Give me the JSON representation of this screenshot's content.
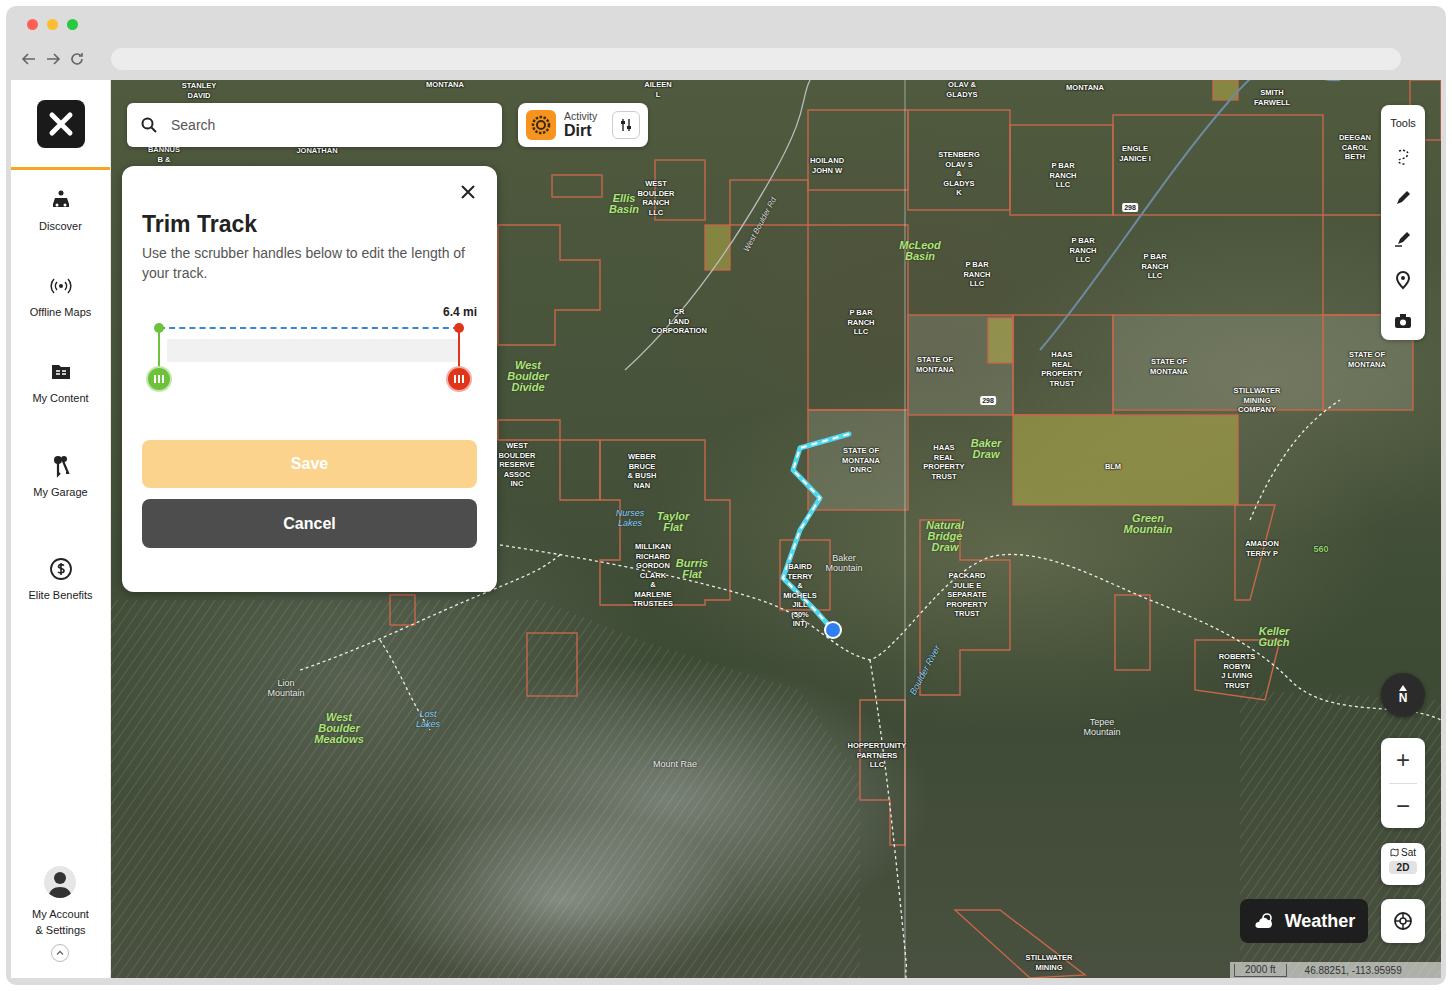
{
  "sidebar": {
    "items": [
      {
        "label": "Discover"
      },
      {
        "label": "Offline Maps"
      },
      {
        "label": "My Content"
      },
      {
        "label": "My Garage"
      },
      {
        "label": "Elite Benefits"
      }
    ],
    "account": "My Account\n& Settings"
  },
  "search": {
    "placeholder": "Search"
  },
  "activity": {
    "label": "Activity",
    "value": "Dirt"
  },
  "trim_panel": {
    "title": "Trim Track",
    "description": "Use the scrubber handles below to edit the length of your track.",
    "distance": "6.4 mi",
    "scrubber": {
      "start": 0,
      "end": 1
    },
    "save": {
      "label": "Save",
      "disabled": true
    },
    "cancel": {
      "label": "Cancel"
    }
  },
  "tools": {
    "title": "Tools"
  },
  "map": {
    "labels": [
      {
        "text": "STANLEY\nDAVID",
        "kind": "owner"
      },
      {
        "text": "MONTANA",
        "kind": "owner"
      },
      {
        "text": "BANNUS\nB &",
        "kind": "owner"
      },
      {
        "text": "JONATHAN",
        "kind": "owner"
      },
      {
        "text": "AILEEN\nL",
        "kind": "owner"
      },
      {
        "text": "WEST\nBOULDER\nRANCH\nLLC",
        "kind": "owner"
      },
      {
        "text": "Ellis\nBasin",
        "kind": "feature"
      },
      {
        "text": "HOILAND\nJOHN W",
        "kind": "owner"
      },
      {
        "text": "OLAV &\nGLADYS",
        "kind": "owner"
      },
      {
        "text": "STENBERG\nOLAV S\n&\nGLADYS\nK",
        "kind": "owner"
      },
      {
        "text": "MONTANA",
        "kind": "owner"
      },
      {
        "text": "SMITH\nFARWELL",
        "kind": "owner"
      },
      {
        "text": "P BAR\nRANCH\nLLC",
        "kind": "owner"
      },
      {
        "text": "ENGLE\nJANICE I",
        "kind": "owner"
      },
      {
        "text": "DEEGAN\nCAROL\nBETH",
        "kind": "owner"
      },
      {
        "text": "McLeod\nBasin",
        "kind": "feature"
      },
      {
        "text": "P BAR\nRANCH\nLLC",
        "kind": "owner"
      },
      {
        "text": "P BAR\nRANCH\nLLC",
        "kind": "owner"
      },
      {
        "text": "P BAR\nRANCH\nLLC",
        "kind": "owner"
      },
      {
        "text": "P BAR\nRANCH\nLLC",
        "kind": "owner"
      },
      {
        "text": "CR\nLAND\nCORPORATION",
        "kind": "owner"
      },
      {
        "text": "STATE OF\nMONTANA",
        "kind": "owner"
      },
      {
        "text": "HAAS\nREAL\nPROPERTY\nTRUST",
        "kind": "owner"
      },
      {
        "text": "STATE OF\nMONTANA",
        "kind": "owner"
      },
      {
        "text": "STATE OF\nMONTANA",
        "kind": "owner"
      },
      {
        "text": "STILLWATER\nMINING\nCOMPANY",
        "kind": "owner"
      },
      {
        "text": "West\nBoulder\nDivide",
        "kind": "feature"
      },
      {
        "text": "WEST\nBOULDER\nRESERVE\nASSOC\nINC",
        "kind": "owner"
      },
      {
        "text": "WEBER\nBRUCE\n& BUSH\nNAN",
        "kind": "owner"
      },
      {
        "text": "STATE OF\nMONTANA\nDNRC",
        "kind": "owner"
      },
      {
        "text": "HAAS\nREAL\nPROPERTY\nTRUST",
        "kind": "owner"
      },
      {
        "text": "Baker\nDraw",
        "kind": "feature"
      },
      {
        "text": "BLM",
        "kind": "owner"
      },
      {
        "text": "Green\nMountain",
        "kind": "feature"
      },
      {
        "text": "Nurses\nLakes",
        "kind": "water"
      },
      {
        "text": "Taylor\nFlat",
        "kind": "feature"
      },
      {
        "text": "MILLIKAN\nRICHARD\nGORDON\nCLARK\n&\nMARLENE\nTRUSTEES",
        "kind": "owner"
      },
      {
        "text": "Burris\nFlat",
        "kind": "feature"
      },
      {
        "text": "BAIRD\nTERRY\n&\nMICHELS\nJILL\n(50%\nINT)",
        "kind": "owner"
      },
      {
        "text": "Baker\nMountain",
        "kind": "peak"
      },
      {
        "text": "Natural\nBridge\nDraw",
        "kind": "feature"
      },
      {
        "text": "PACKARD\nJULIE E\nSEPARATE\nPROPERTY\nTRUST",
        "kind": "owner"
      },
      {
        "text": "AMADON\nTERRY P",
        "kind": "owner"
      },
      {
        "text": "560",
        "kind": "number"
      },
      {
        "text": "Keller\nGulch",
        "kind": "feature"
      },
      {
        "text": "ROBERTS\nROBYN\nJ LIVING\nTRUST",
        "kind": "owner"
      },
      {
        "text": "Lion\nMountain",
        "kind": "peak"
      },
      {
        "text": "West\nBoulder\nMeadows",
        "kind": "feature"
      },
      {
        "text": "Lost\nLakes",
        "kind": "water"
      },
      {
        "text": "Mount Rae",
        "kind": "peak"
      },
      {
        "text": "Tepee\nMountain",
        "kind": "peak"
      },
      {
        "text": "HOPPERTUNITY\nPARTNERS\nLLC",
        "kind": "owner"
      },
      {
        "text": "STILLWATER\nMINING",
        "kind": "owner"
      },
      {
        "text": "298",
        "kind": "shield"
      },
      {
        "text": "298",
        "kind": "shield"
      },
      {
        "text": "Boulder River",
        "kind": "river"
      },
      {
        "text": "West Boulder Rd",
        "kind": "road"
      }
    ],
    "compass": "N",
    "zoom_in": "+",
    "zoom_out": "−",
    "layer": "Sat",
    "view": "2D",
    "scale": "2000 ft",
    "coordinates": "46.88251, -113.95959"
  },
  "weather": {
    "label": "Weather"
  }
}
